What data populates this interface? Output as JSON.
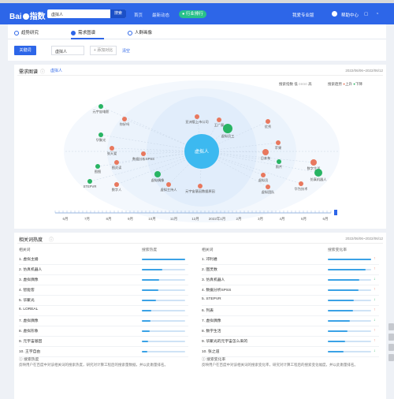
{
  "header": {
    "logo": "Bai",
    "logo_suffix": "指数",
    "search_query": "虚拟人",
    "search_button": "搜索",
    "nav": [
      "首页",
      "最新动态",
      "行业排行"
    ],
    "active_nav": "行业排行",
    "right_nav": [
      "我爱专业版",
      "帮助中心"
    ]
  },
  "tabs": [
    "趋势研究",
    "需求图谱",
    "人群画像"
  ],
  "active_tab": "需求图谱",
  "keyword_bar": {
    "label": "关键词",
    "value": "虚拟人",
    "add_label": "+ 添加对比",
    "clear_label": "清空"
  },
  "demand_map": {
    "title": "需求图谱",
    "subtab": "虚拟人",
    "date_range": "2022/06/06~2022/06/12",
    "legend_search": "搜索指数",
    "legend_low": "低",
    "legend_high": "高",
    "legend_trend": "搜索趋势",
    "legend_up": "上升",
    "legend_down": "下降",
    "center": "虚拟人",
    "nodes": [
      {
        "label": "元宇宙电影",
        "color": "#28b463"
      },
      {
        "label": "你好吗",
        "color": "#e8785e"
      },
      {
        "label": "华聚光",
        "color": "#28b463"
      },
      {
        "label": "张天爱",
        "color": "#e8785e"
      },
      {
        "label": "图灵读",
        "color": "#e8785e"
      },
      {
        "label": "图图",
        "color": "#28b463"
      },
      {
        "label": "数据分析SPSS",
        "color": "#e8785e"
      },
      {
        "label": "虚拟偶像",
        "color": "#28b463"
      },
      {
        "label": "虚拟主持人",
        "color": "#e8785e"
      },
      {
        "label": "元宇宙基因数据原因",
        "color": "#e8785e"
      },
      {
        "label": "亚洲版上市公司",
        "color": "#e8785e"
      },
      {
        "label": "王广磊",
        "color": "#e8785e"
      },
      {
        "label": "虚拟员工",
        "color": "#28b463"
      },
      {
        "label": "优秀",
        "color": "#e8785e"
      },
      {
        "label": "日本车",
        "color": "#e8785e"
      },
      {
        "label": "苹果",
        "color": "#e8785e"
      },
      {
        "label": "照片",
        "color": "#28b463"
      },
      {
        "label": "数字生活",
        "color": "#e8785e"
      },
      {
        "label": "虚拟员",
        "color": "#e8785e"
      },
      {
        "label": "虚拟团队",
        "color": "#e8785e"
      },
      {
        "label": "华为技术",
        "color": "#e8785e"
      },
      {
        "label": "仿真机器人",
        "color": "#28b463"
      },
      {
        "label": "STEPVR",
        "color": "#28b463"
      },
      {
        "label": "数字人",
        "color": "#e8785e"
      }
    ]
  },
  "timeline": {
    "labels": [
      "6月",
      "7月",
      "8月",
      "9月",
      "10月",
      "11月",
      "12月",
      "2022年1月",
      "2月",
      "3月",
      "4月",
      "5月",
      "6月"
    ]
  },
  "related": {
    "title": "相关词热度",
    "date_range": "2022/06/06~2022/06/12",
    "left": {
      "head_word": "相关词",
      "head_metric": "搜索热度",
      "rows": [
        {
          "rank": "1.",
          "word": "虚拟主播",
          "value": 1.0
        },
        {
          "rank": "2.",
          "word": "仿真机器人",
          "value": 0.48
        },
        {
          "rank": "3.",
          "word": "虚拟偶像",
          "value": 0.4
        },
        {
          "rank": "4.",
          "word": "智能客",
          "value": 0.38
        },
        {
          "rank": "5.",
          "word": "华聚光",
          "value": 0.32
        },
        {
          "rank": "6.",
          "word": "LOREAL",
          "value": 0.22
        },
        {
          "rank": "7.",
          "word": "虚拟偶像",
          "value": 0.2
        },
        {
          "rank": "8.",
          "word": "虚拟形象",
          "value": 0.18
        },
        {
          "rank": "9.",
          "word": "元宇宙基因",
          "value": 0.14
        },
        {
          "rank": "10.",
          "word": "王宇自由",
          "value": 0.12
        }
      ]
    },
    "right": {
      "head_word": "相关词",
      "head_metric": "搜索变化率",
      "rows": [
        {
          "rank": "1.",
          "word": "邓利君",
          "value": 1.0,
          "trend": "up"
        },
        {
          "rank": "2.",
          "word": "图灵数",
          "value": 0.88,
          "trend": "up"
        },
        {
          "rank": "3.",
          "word": "仿真机器人",
          "value": 0.72,
          "trend": "down"
        },
        {
          "rank": "4.",
          "word": "数据分析SPSS",
          "value": 0.7,
          "trend": "up"
        },
        {
          "rank": "5.",
          "word": "STEPVR",
          "value": 0.6,
          "trend": "down"
        },
        {
          "rank": "6.",
          "word": "列表",
          "value": 0.58,
          "trend": "up"
        },
        {
          "rank": "7.",
          "word": "虚拟偶像",
          "value": 0.5,
          "trend": "down"
        },
        {
          "rank": "8.",
          "word": "数字生活",
          "value": 0.46,
          "trend": "up"
        },
        {
          "rank": "9.",
          "word": "华聚光的元宇宙怎么来的",
          "value": 0.4,
          "trend": "up"
        },
        {
          "rank": "10.",
          "word": "张之道",
          "value": 0.36,
          "trend": "down"
        }
      ]
    },
    "note_left_title": "搜索热度",
    "note_left": "反映用户在百度中对该相关词的搜索热度，研究对计算工程后的搜索量数据，并以此衡量排名。",
    "note_right_title": "搜索变化率",
    "note_right": "反映用户在百度中对该相关词的搜索变化率，研究对计算工程后的搜索变化幅度，并以此衡量排名。"
  },
  "colors": {
    "primary": "#2d66e8",
    "up": "#e8785e",
    "down": "#28b463"
  }
}
